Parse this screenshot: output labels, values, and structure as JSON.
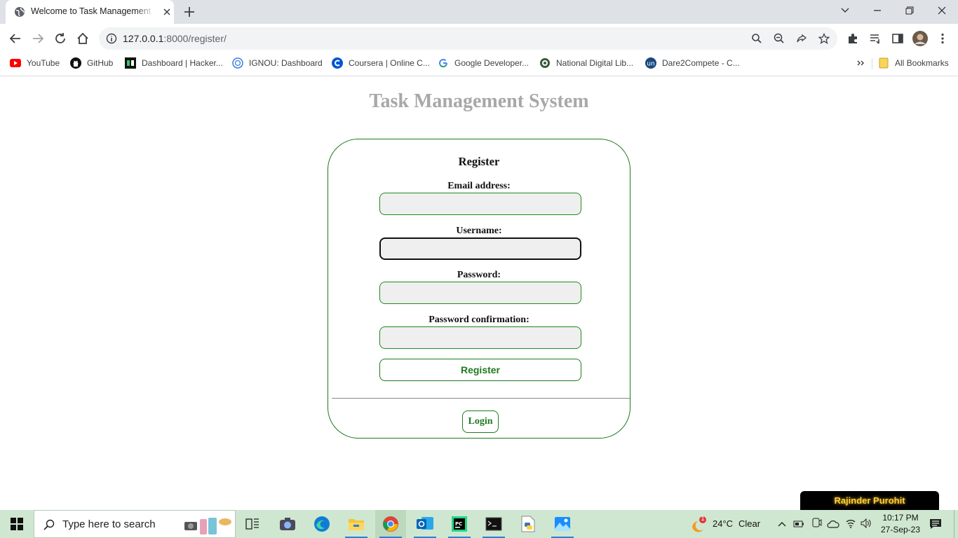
{
  "browser": {
    "tab_title": "Welcome to Task Management System",
    "url_host": "127.0.0.1",
    "url_path": ":8000/register/",
    "bookmarks": [
      {
        "label": "YouTube",
        "icon": "youtube-icon"
      },
      {
        "label": "GitHub",
        "icon": "github-icon"
      },
      {
        "label": "Dashboard | Hacker...",
        "icon": "hackerrank-icon"
      },
      {
        "label": "IGNOU: Dashboard",
        "icon": "ignou-icon"
      },
      {
        "label": "Coursera | Online C...",
        "icon": "coursera-icon"
      },
      {
        "label": "Google Developer...",
        "icon": "google-icon"
      },
      {
        "label": "National Digital Lib...",
        "icon": "ndl-icon"
      },
      {
        "label": "Dare2Compete - C...",
        "icon": "unstop-icon"
      }
    ],
    "all_bookmarks_label": "All Bookmarks"
  },
  "page": {
    "title": "Task Management System",
    "card_heading": "Register",
    "fields": {
      "email_label": "Email address:",
      "username_label": "Username:",
      "password_label": "Password:",
      "password_confirm_label": "Password confirmation:"
    },
    "register_button": "Register",
    "login_button": "Login",
    "badge": "Rajinder Purohit"
  },
  "taskbar": {
    "search_placeholder": "Type here to search",
    "weather_temp": "24°C",
    "weather_text": "Clear",
    "time": "10:17 PM",
    "date": "27-Sep-23",
    "notification_count": "1"
  },
  "colors": {
    "accent_green": "#1e7a1e",
    "title_gray": "#a8a8a8",
    "taskbar_bg": "#cfe7d0",
    "badge_text": "#f5d142"
  }
}
